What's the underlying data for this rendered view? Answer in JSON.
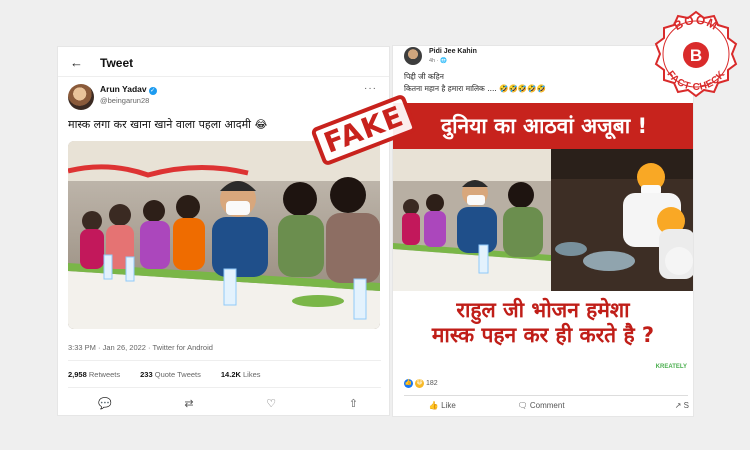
{
  "twitter": {
    "back_glyph": "←",
    "title": "Tweet",
    "name": "Arun Yadav",
    "verified_glyph": "✓",
    "handle": "@beingarun28",
    "more_glyph": "···",
    "text": "मास्क लगा कर खाना खाने वाला पहला आदमी 😂",
    "meta": "3:33 PM · Jan 26, 2022 · Twitter for Android",
    "stats": {
      "retweets_count": "2,958",
      "retweets_label": "Retweets",
      "quote_count": "233",
      "quote_label": "Quote Tweets",
      "likes_count": "14.2K",
      "likes_label": "Likes"
    },
    "actions": {
      "reply_glyph": "💬",
      "retweet_glyph": "⇄",
      "like_glyph": "♡",
      "share_glyph": "⇧"
    }
  },
  "facebook": {
    "name": "Pidi Jee Kahin",
    "time": "4h · 🌐",
    "line1": "पिद्दी जी कहिन",
    "line2": "कितना महान है हमारा मालिक .... 🤣🤣🤣🤣🤣",
    "banner": "दुनिया का आठवां अजूबा !",
    "caption_line1": "राहुल जी भोजन हमेशा",
    "caption_line2": "मास्क पहन कर ही करते है ?",
    "watermark": "KREATELY",
    "reaction_count": "182",
    "actions": {
      "like_label": "Like",
      "comment_label": "Comment",
      "share_label": "S"
    }
  },
  "stamp": {
    "text": "FAKE"
  },
  "badge": {
    "top_text": "BOOM",
    "letter": "B",
    "bottom_text": "FACT CHECK"
  },
  "colors": {
    "stamp_red": "#c8221d",
    "banner_red": "#c7231d",
    "caption_red": "#c01e18",
    "twitter_blue": "#1d9bf0"
  }
}
